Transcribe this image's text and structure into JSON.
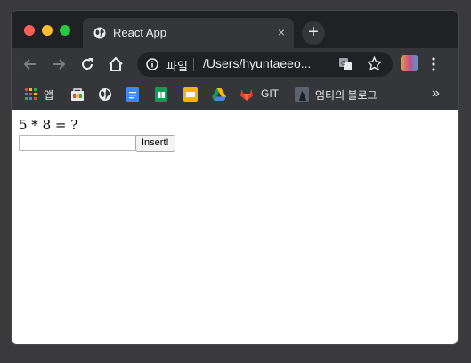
{
  "window": {
    "tab_title": "React App",
    "new_tab_label": "+",
    "close_label": "×"
  },
  "toolbar": {
    "scheme_label": "파일",
    "url": "/Users/hyuntaeeo..."
  },
  "bookmarks": {
    "items": [
      {
        "label": "앱",
        "icon": "apps-grid-icon"
      },
      {
        "label": "",
        "icon": "web-store-icon"
      },
      {
        "label": "",
        "icon": "globe-icon"
      },
      {
        "label": "",
        "icon": "google-docs-icon"
      },
      {
        "label": "",
        "icon": "google-sheets-icon"
      },
      {
        "label": "",
        "icon": "google-slides-icon"
      },
      {
        "label": "",
        "icon": "google-drive-icon"
      },
      {
        "label": "GIT",
        "icon": "gitlab-icon"
      },
      {
        "label": "엄티의 블로그",
        "icon": "blog-avatar-icon"
      }
    ],
    "overflow_label": "»"
  },
  "page": {
    "question": "5 * 8 = ?",
    "answer_value": "",
    "insert_label": "Insert!"
  },
  "colors": {
    "chrome_dark": "#202124",
    "chrome_toolbar": "#35363a",
    "traffic_red": "#ff5f57",
    "traffic_yellow": "#febc2e",
    "traffic_green": "#28c840"
  }
}
